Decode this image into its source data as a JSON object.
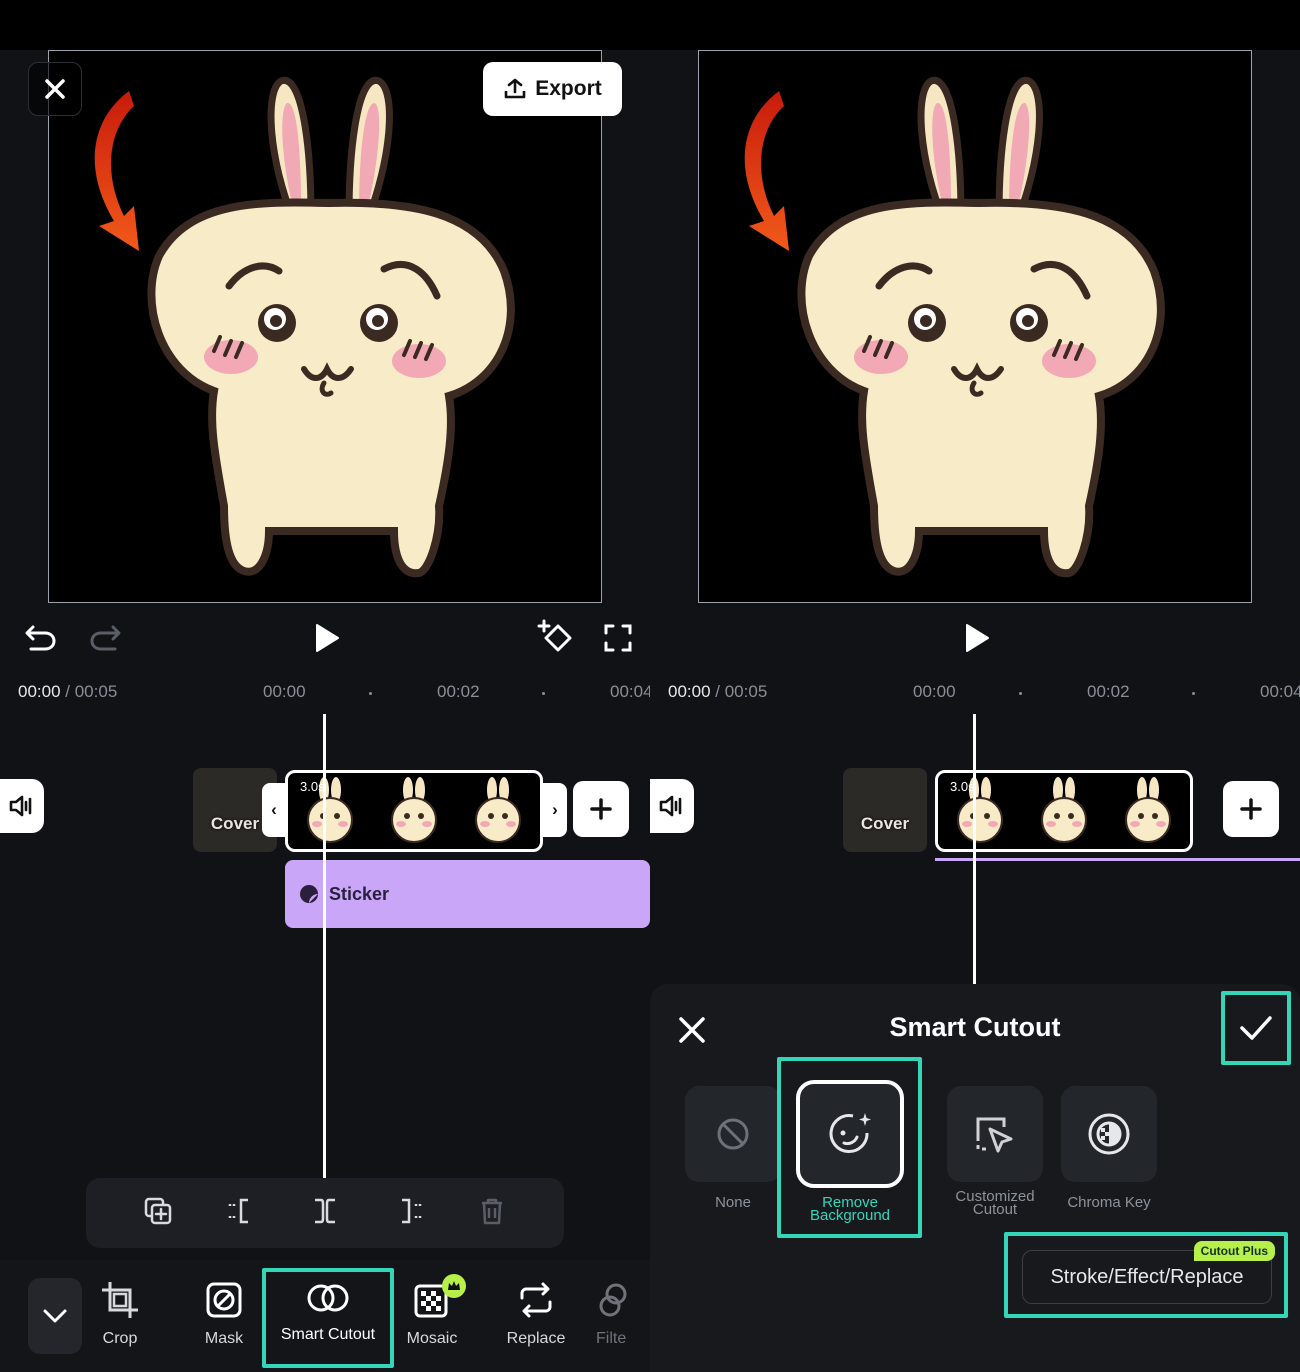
{
  "left": {
    "export_label": "Export",
    "time_current": "00:00",
    "time_total": "/ 00:05",
    "ticks": [
      "00:00",
      "00:02",
      "00:04"
    ],
    "clip_duration": "3.0s",
    "cover_label": "Cover",
    "sticker_label": "Sticker",
    "tools": [
      {
        "label": "Crop",
        "icon": "crop-icon"
      },
      {
        "label": "Mask",
        "icon": "mask-icon"
      },
      {
        "label": "Smart Cutout",
        "icon": "smart-cutout-icon"
      },
      {
        "label": "Mosaic",
        "icon": "mosaic-icon"
      },
      {
        "label": "Replace",
        "icon": "replace-icon"
      },
      {
        "label": "Filte",
        "icon": "filter-icon"
      }
    ]
  },
  "right": {
    "time_current": "00:00",
    "time_total": "/ 00:05",
    "ticks": [
      "00:00",
      "00:02",
      "00:04"
    ],
    "clip_duration": "3.0s",
    "cover_label": "Cover",
    "sheet": {
      "title": "Smart Cutout",
      "options": [
        {
          "label": "None",
          "icon": "none-icon"
        },
        {
          "label_1": "Remove",
          "label_2": "Background",
          "icon": "remove-background-icon"
        },
        {
          "label_1": "Customized",
          "label_2": "Cutout",
          "icon": "customized-cutout-icon"
        },
        {
          "label": "Chroma Key",
          "icon": "chroma-key-icon"
        }
      ],
      "stroke_button": "Stroke/Effect/Replace",
      "badge": "Cutout Plus"
    }
  },
  "colors": {
    "accent_highlight": "#34d6b8",
    "sticker_track": "#c9a6f7",
    "badge": "#b7f04a"
  }
}
